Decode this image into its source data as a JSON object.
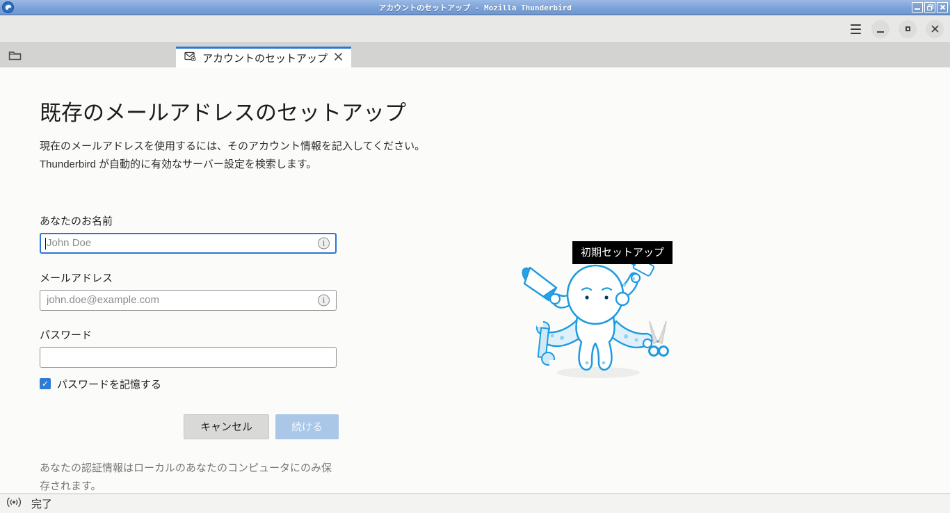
{
  "window": {
    "title": "アカウントのセットアップ - Mozilla Thunderbird"
  },
  "tabbar": {
    "tab_label": "アカウントのセットアップ"
  },
  "setup": {
    "heading": "既存のメールアドレスのセットアップ",
    "description": "現在のメールアドレスを使用するには、そのアカウント情報を記入してください。\nThunderbird が自動的に有効なサーバー設定を検索します。",
    "fields": {
      "name": {
        "label": "あなたのお名前",
        "placeholder": "John Doe",
        "value": ""
      },
      "email": {
        "label": "メールアドレス",
        "placeholder": "john.doe@example.com",
        "value": ""
      },
      "password": {
        "label": "パスワード",
        "placeholder": "",
        "value": ""
      }
    },
    "remember_password": {
      "label": "パスワードを記憶する",
      "checked": true
    },
    "buttons": {
      "cancel": "キャンセル",
      "continue": "続ける"
    },
    "continue_disabled": true,
    "privacy_note": "あなたの認証情報はローカルのあなたのコンピュータにのみ保存されます。",
    "tooltip": "初期セットアップ"
  },
  "statusbar": {
    "status": "完了"
  },
  "icons": {
    "info": "i",
    "check": "✓"
  },
  "colors": {
    "accent_blue": "#2a76d2",
    "titlebar_top": "#9cb9e5",
    "titlebar_bottom": "#6f97d0",
    "checkbox_blue": "#2e7cd6",
    "continue_bg": "#aac7e8",
    "mascot_blue": "#1e9be0",
    "tooltip_bg": "#000000",
    "tab_active_bg": "#ffffff",
    "tabbar_bg": "#d3d3d2"
  }
}
